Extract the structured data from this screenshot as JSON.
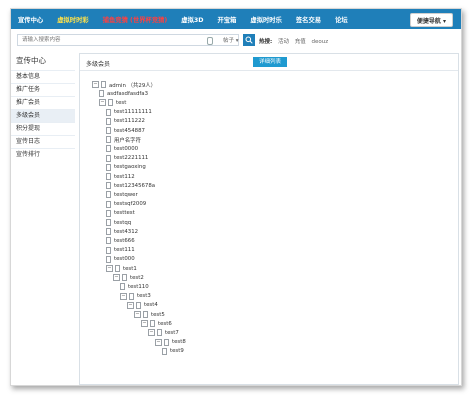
{
  "topnav": {
    "items": [
      {
        "label": "宣传中心"
      },
      {
        "label": "虚拟时时彩"
      },
      {
        "label": "捕鱼竞猜 (世界杯竞猜)"
      },
      {
        "label": "虚拟3D"
      },
      {
        "label": "开宝箱"
      },
      {
        "label": "虚拟时时乐"
      },
      {
        "label": "签名交易"
      },
      {
        "label": "论坛"
      }
    ],
    "right_label": "便捷导航 ▾"
  },
  "search": {
    "placeholder": "请输入搜索内容",
    "type": "帖子 ▾",
    "hot_label": "热搜:",
    "hot_terms": [
      "活动",
      "充值",
      "deouz"
    ]
  },
  "sidebar": {
    "title": "宣传中心",
    "items": [
      {
        "label": "基本信息"
      },
      {
        "label": "推广任务"
      },
      {
        "label": "推广会员"
      },
      {
        "label": "多级会员"
      },
      {
        "label": "积分提现"
      },
      {
        "label": "宣传日志"
      },
      {
        "label": "宣传排行"
      }
    ]
  },
  "main": {
    "title": "多级会员",
    "detail_button": "详细列表",
    "tree": [
      {
        "label": "admin （共29人）",
        "toggle": "−"
      },
      {
        "label": "asdfasdfasdfa3",
        "toggle": ""
      },
      {
        "label": "test",
        "toggle": "−"
      },
      {
        "label": "test11111111",
        "toggle": ""
      },
      {
        "label": "test111222",
        "toggle": ""
      },
      {
        "label": "test454887",
        "toggle": ""
      },
      {
        "label": "用户名字符",
        "toggle": ""
      },
      {
        "label": "test0000",
        "toggle": ""
      },
      {
        "label": "test2221111",
        "toggle": ""
      },
      {
        "label": "testgaoxing",
        "toggle": ""
      },
      {
        "label": "test112",
        "toggle": ""
      },
      {
        "label": "test12345678a",
        "toggle": ""
      },
      {
        "label": "testqwer",
        "toggle": ""
      },
      {
        "label": "testsqf2009",
        "toggle": ""
      },
      {
        "label": "testtest",
        "toggle": ""
      },
      {
        "label": "testqq",
        "toggle": ""
      },
      {
        "label": "test4312",
        "toggle": ""
      },
      {
        "label": "test666",
        "toggle": ""
      },
      {
        "label": "test111",
        "toggle": ""
      },
      {
        "label": "test000",
        "toggle": ""
      },
      {
        "label": "test1",
        "toggle": "−"
      },
      {
        "label": "test2",
        "toggle": "−"
      },
      {
        "label": "test110",
        "toggle": ""
      },
      {
        "label": "test3",
        "toggle": "−"
      },
      {
        "label": "test4",
        "toggle": "−"
      },
      {
        "label": "test5",
        "toggle": "−"
      },
      {
        "label": "test6",
        "toggle": "−"
      },
      {
        "label": "test7",
        "toggle": "−"
      },
      {
        "label": "test8",
        "toggle": "−"
      },
      {
        "label": "test9",
        "toggle": ""
      }
    ]
  }
}
